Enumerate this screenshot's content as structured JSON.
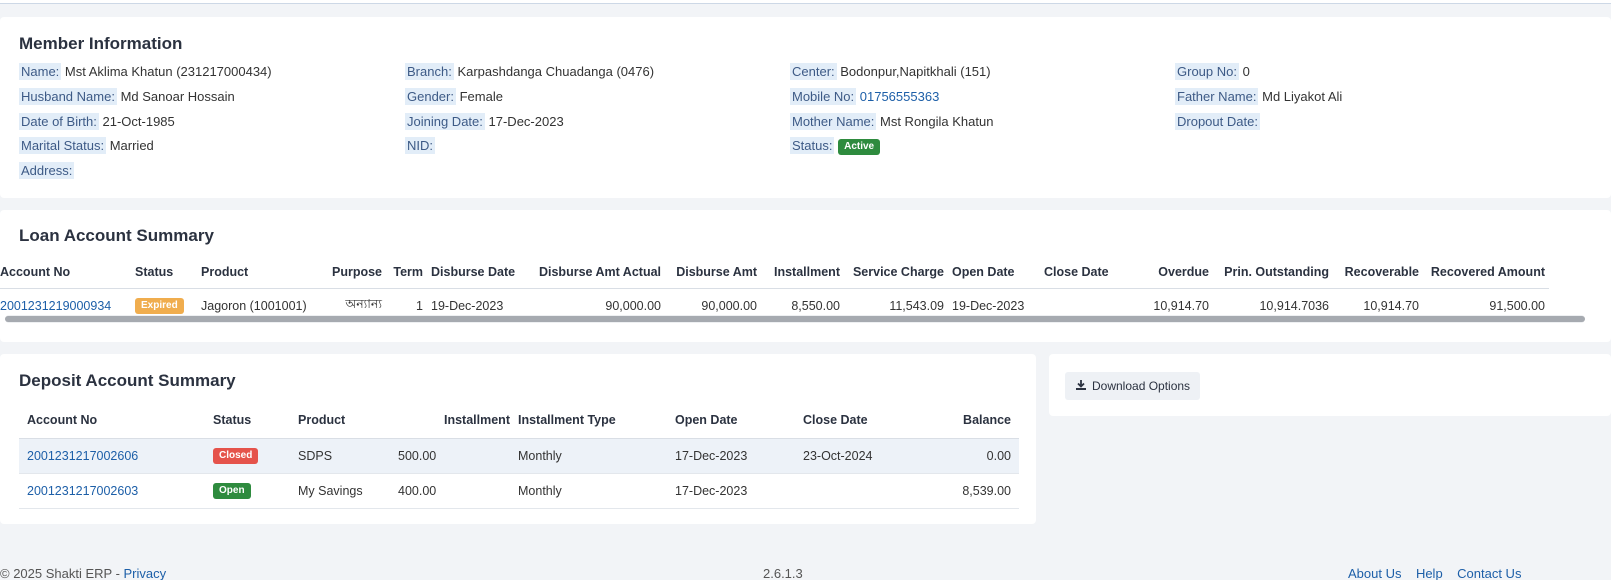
{
  "member": {
    "title": "Member Information",
    "fields": {
      "name_label": "Name:",
      "name": "Mst Aklima Khatun (231217000434)",
      "branch_label": "Branch:",
      "branch": "Karpashdanga Chuadanga (0476)",
      "center_label": "Center:",
      "center": "Bodonpur,Napitkhali (151)",
      "group_label": "Group No:",
      "group": "0",
      "husband_label": "Husband Name:",
      "husband": "Md Sanoar Hossain",
      "gender_label": "Gender:",
      "gender": "Female",
      "mobile_label": "Mobile No:",
      "mobile": "01756555363",
      "father_label": "Father Name:",
      "father": "Md Liyakot Ali",
      "dob_label": "Date of Birth:",
      "dob": "21-Oct-1985",
      "joining_label": "Joining Date:",
      "joining": "17-Dec-2023",
      "mother_label": "Mother Name:",
      "mother": "Mst Rongila Khatun",
      "dropout_label": "Dropout Date:",
      "marital_label": "Marital Status:",
      "marital": "Married",
      "nid_label": "NID:",
      "status_label": "Status:",
      "status": "Active",
      "address_label": "Address:"
    }
  },
  "loan": {
    "title": "Loan Account Summary",
    "headers": [
      "Account No",
      "Status",
      "Product",
      "Purpose",
      "Term",
      "Disburse Date",
      "Disburse Amt Actual",
      "Disburse Amt",
      "Installment",
      "Service Charge",
      "Open Date",
      "Close Date",
      "Overdue",
      "Prin. Outstanding",
      "Recoverable",
      "Recovered Amount"
    ],
    "rows": [
      {
        "account_no": "2001231219000934",
        "status": "Expired",
        "product": "Jagoron (1001001)",
        "purpose": "অন্যান্য",
        "term": "1",
        "disburse_date": "19-Dec-2023",
        "disburse_amt_actual": "90,000.00",
        "disburse_amt": "90,000.00",
        "installment": "8,550.00",
        "service_charge": "11,543.09",
        "open_date": "19-Dec-2023",
        "close_date": "",
        "overdue": "10,914.70",
        "prin_outstanding": "10,914.7036",
        "recoverable": "10,914.70",
        "recovered_amount": "91,500.00"
      }
    ]
  },
  "deposit": {
    "title": "Deposit Account Summary",
    "headers": [
      "Account No",
      "Status",
      "Product",
      "Installment",
      "Installment Type",
      "Open Date",
      "Close Date",
      "Balance"
    ],
    "rows": [
      {
        "account_no": "2001231217002606",
        "status": "Closed",
        "product": "SDPS",
        "installment": "500.00",
        "installment_type": "Monthly",
        "open_date": "17-Dec-2023",
        "close_date": "23-Oct-2024",
        "balance": "0.00"
      },
      {
        "account_no": "2001231217002603",
        "status": "Open",
        "product": "My Savings",
        "installment": "400.00",
        "installment_type": "Monthly",
        "open_date": "17-Dec-2023",
        "close_date": "",
        "balance": "8,539.00"
      }
    ]
  },
  "download": {
    "label": "Download Options",
    "icon": "download-icon"
  },
  "footer": {
    "left": "© 2025 Shakti ERP - ",
    "left_link": "Privacy",
    "center": "2.6.1.3",
    "right_1": "About Us",
    "right_2": "Help",
    "right_3": "Contact Us"
  },
  "colors": {
    "active": "#2e8b3e",
    "expired": "#f0ad4e",
    "closed": "#e5534b",
    "link": "#1d5fa8"
  }
}
